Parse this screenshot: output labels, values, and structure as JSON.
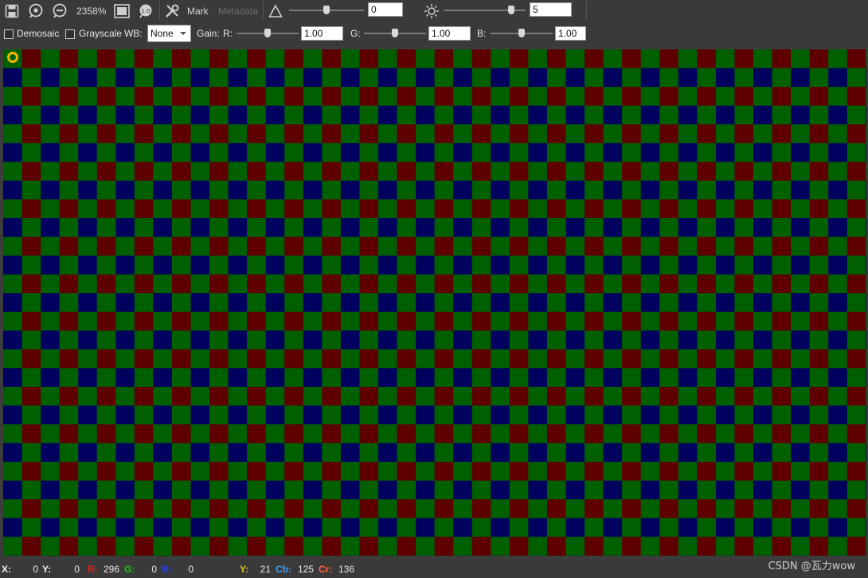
{
  "toolbar": {
    "zoom_label": "2358%",
    "mark_label": "Mark",
    "metadata_label": "Metadata",
    "contrast_value": "0",
    "brightness_value": "5",
    "contrast_slider_level": 0.5,
    "brightness_slider_level": 0.85
  },
  "options": {
    "demosaic_label": "Demosaic",
    "demosaic_checked": false,
    "grayscale_label": "Grayscale",
    "grayscale_checked": false,
    "wb_label": "WB:",
    "wb_value": "None",
    "gain_label": "Gain:",
    "r_label": "R:",
    "g_label": "G:",
    "b_label": "B:",
    "r_value": "1.00",
    "g_value": "1.00",
    "b_value": "1.00",
    "r_slider_level": 0.5,
    "g_slider_level": 0.5,
    "b_slider_level": 0.5
  },
  "image": {
    "pattern": "bayer",
    "colors": {
      "red": "#5e0000",
      "green": "#006000",
      "blue": "#00005e"
    }
  },
  "status": {
    "x_label": "X:",
    "x_value": "0",
    "y_label": "Y:",
    "y_value": "0",
    "r_label": "R:",
    "r_value": "296",
    "g_label": "G:",
    "g_value": "0",
    "b_label": "B:",
    "b_value": "0",
    "yy_label": "Y:",
    "yy_value": "21",
    "cb_label": "Cb:",
    "cb_value": "125",
    "cr_label": "Cr:",
    "cr_value": "136",
    "colors": {
      "r": "#e02020",
      "g": "#20c020",
      "b": "#2040ff",
      "y": "#e0c020",
      "cb": "#3aa0ff",
      "cr": "#ff6a40"
    }
  },
  "watermark": "CSDN @瓦力wow"
}
